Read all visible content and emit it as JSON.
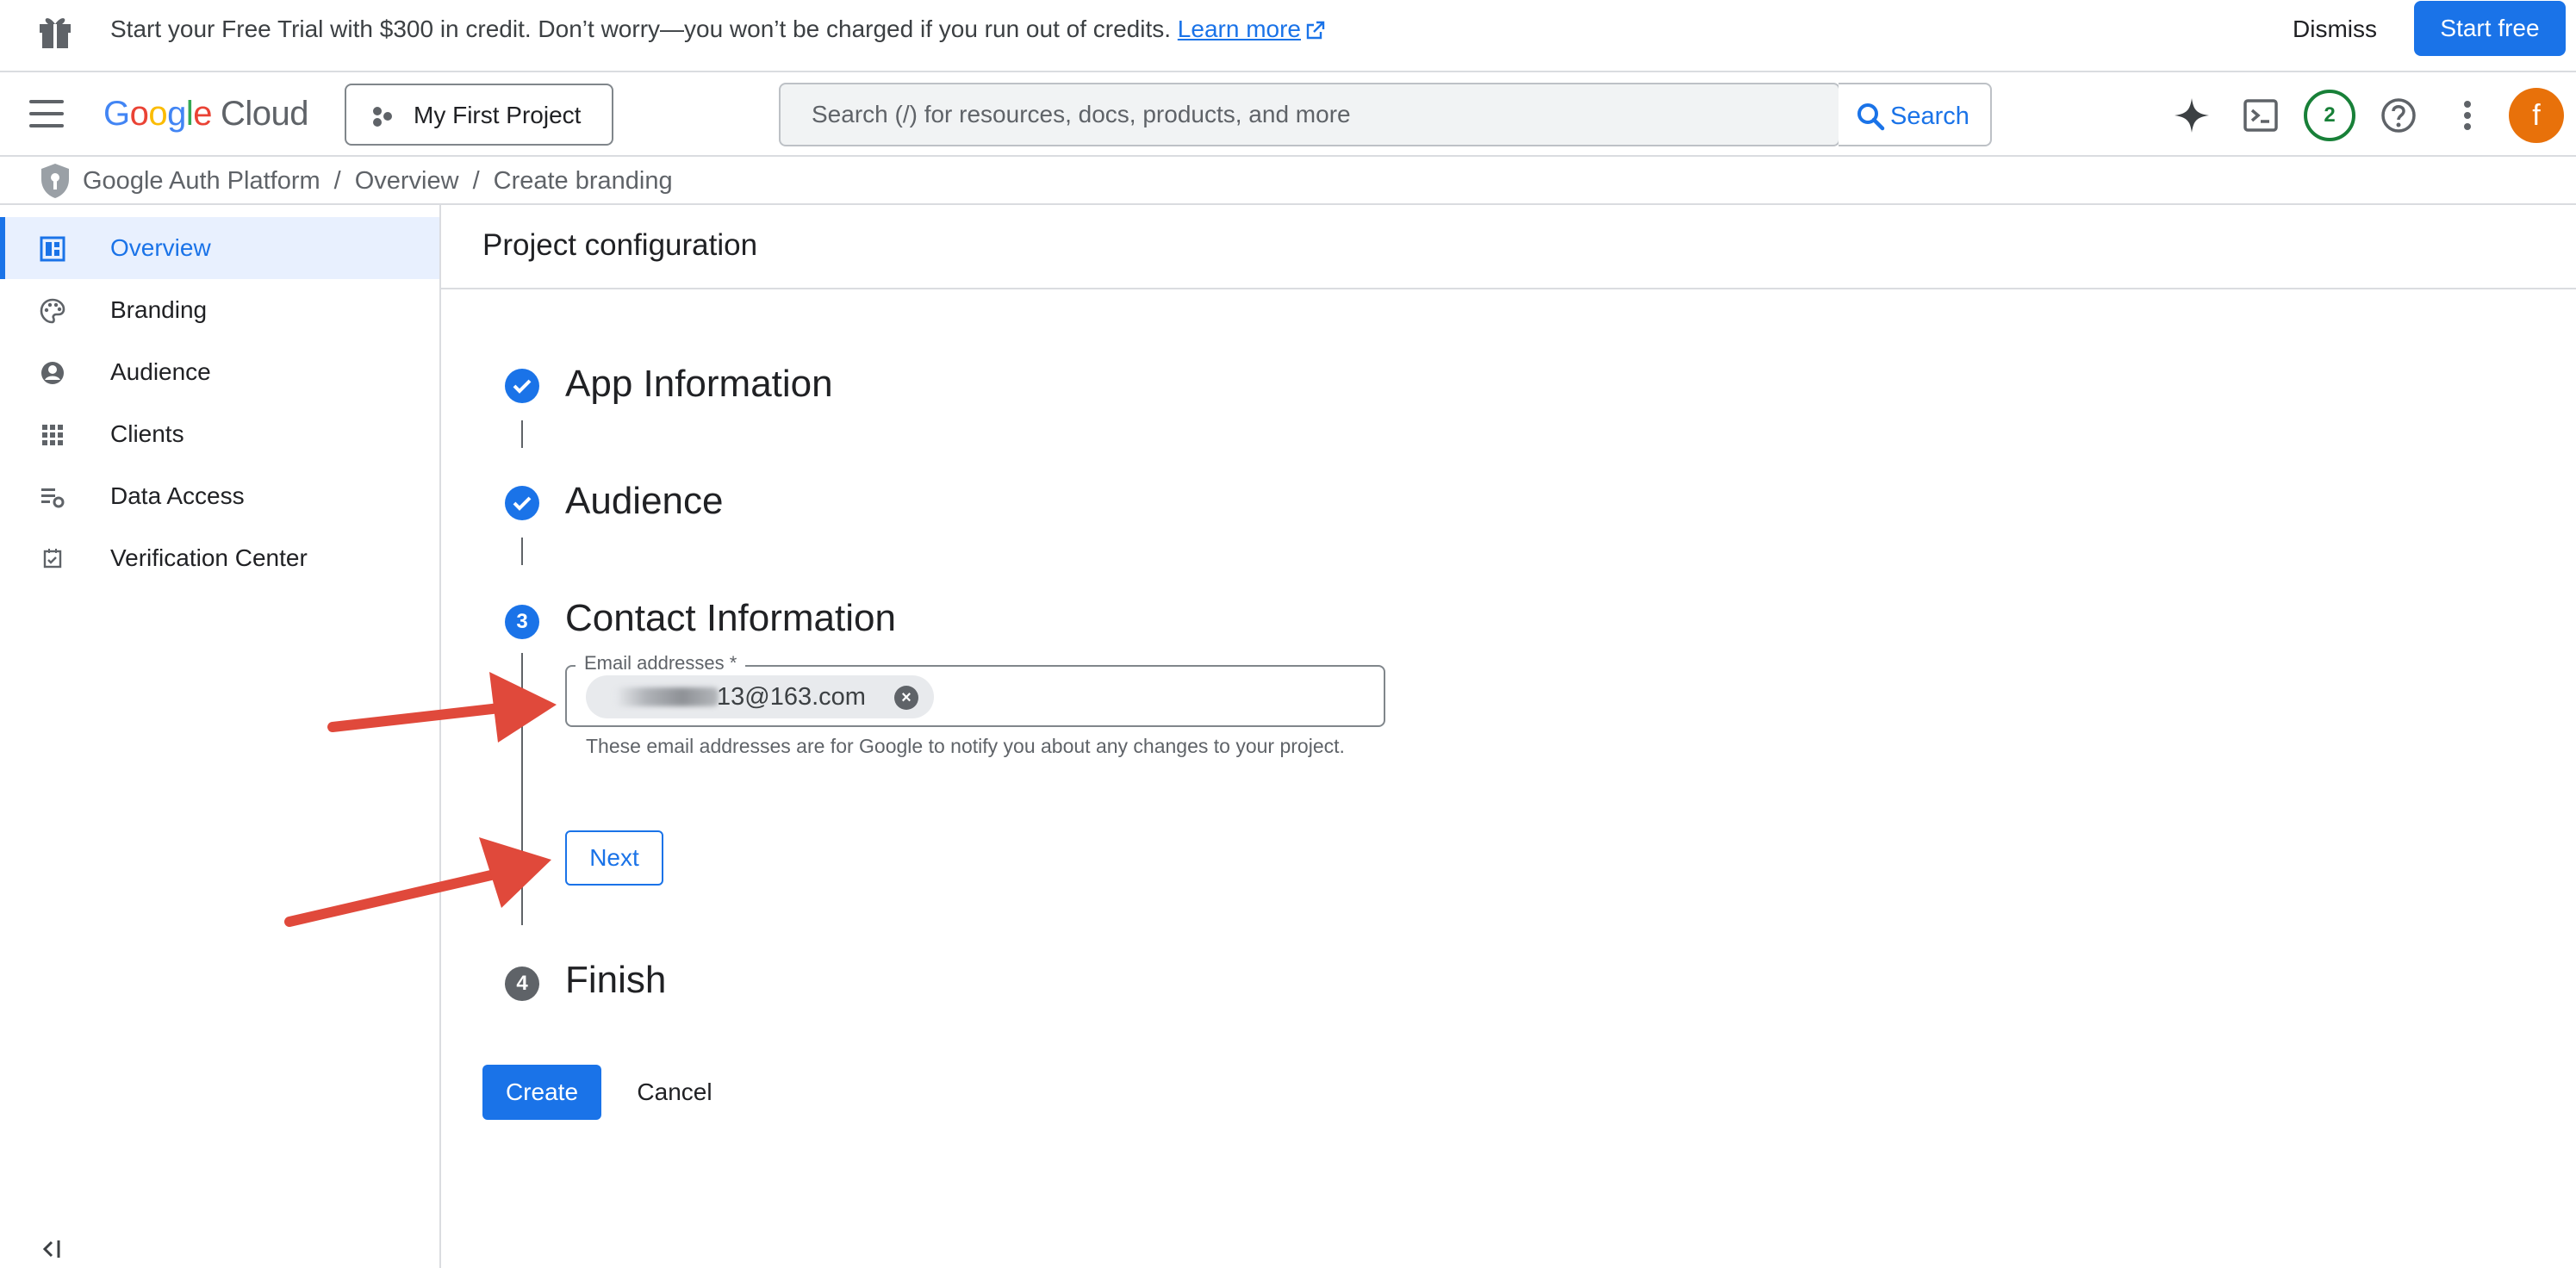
{
  "promo_banner": {
    "message": "Start your Free Trial with $300 in credit. Don’t worry—you won’t be charged if you run out of credits.",
    "learn_more": "Learn more",
    "dismiss_label": "Dismiss",
    "start_free_label": "Start free",
    "icons": {
      "gift": "gift-icon",
      "external": "open-in-new-icon"
    }
  },
  "header": {
    "logo_letters": [
      "G",
      "o",
      "o",
      "g",
      "l",
      "e"
    ],
    "logo_product": "Cloud",
    "project_selector": "My First Project",
    "search": {
      "placeholder": "Search (/) for resources, docs, products, and more",
      "value": "",
      "button_label": "Search"
    },
    "notifications_count": "2",
    "avatar_initial": "f",
    "icons": [
      "menu-icon",
      "gemini-sparkle-icon",
      "cloud-shell-icon",
      "help-icon",
      "more-vert-icon"
    ]
  },
  "breadcrumb": {
    "items": [
      "Google Auth Platform",
      "Overview",
      "Create branding"
    ],
    "separator": "/"
  },
  "sidebar": {
    "items": [
      {
        "label": "Overview",
        "icon": "dashboard-icon",
        "active": true
      },
      {
        "label": "Branding",
        "icon": "palette-icon",
        "active": false
      },
      {
        "label": "Audience",
        "icon": "account-circle-icon",
        "active": false
      },
      {
        "label": "Clients",
        "icon": "apps-grid-icon",
        "active": false
      },
      {
        "label": "Data Access",
        "icon": "data-settings-icon",
        "active": false
      },
      {
        "label": "Verification Center",
        "icon": "checkbox-calendar-icon",
        "active": false
      }
    ]
  },
  "main": {
    "page_title": "Project configuration",
    "steps": [
      {
        "number": "1",
        "title": "App Information",
        "state": "done"
      },
      {
        "number": "2",
        "title": "Audience",
        "state": "done"
      },
      {
        "number": "3",
        "title": "Contact Information",
        "state": "current"
      },
      {
        "number": "4",
        "title": "Finish",
        "state": "future"
      }
    ],
    "email_field": {
      "label": "Email addresses *",
      "chip_value": "13@163.com",
      "helper": "These email addresses are for Google to notify you about any changes to your project."
    },
    "next_label": "Next",
    "create_label": "Create",
    "cancel_label": "Cancel"
  },
  "colors": {
    "accent": "#1a73e8",
    "active_nav_bg": "#e8f0fe",
    "annotation_arrow": "#e0493b",
    "avatar": "#e8710a",
    "notification_badge": "#188038"
  }
}
